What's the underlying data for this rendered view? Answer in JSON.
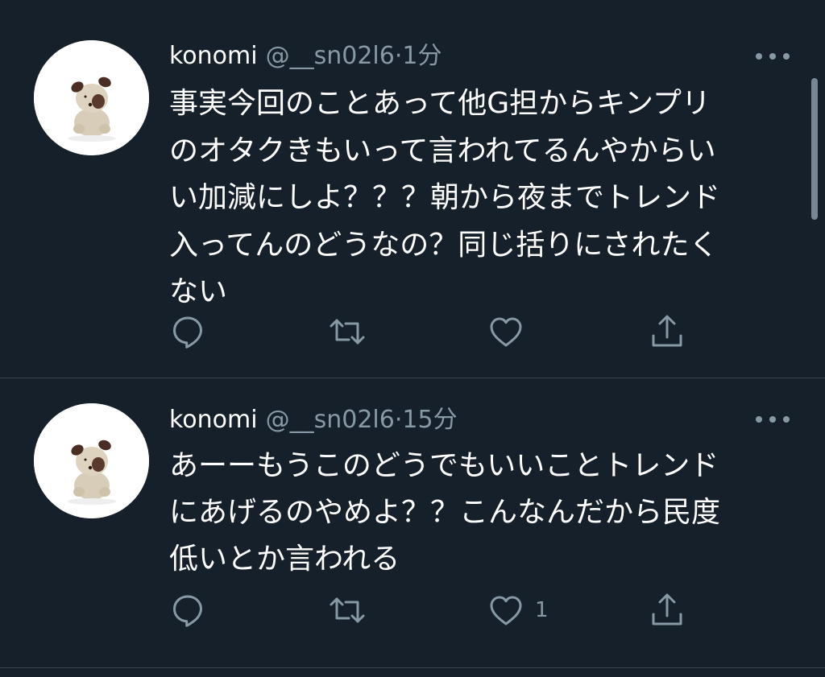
{
  "tweets": [
    {
      "name": "konomi",
      "handle": "@__sn02l6",
      "separator": "·",
      "time": "1分",
      "text": "事実今回のことあって他G担からキンプリ\nのオタクきもいって言われてるんやからい\nい加減にしよ？？？朝から夜までトレンド\n入ってんのどうなの？同じ括りにされたく\nない",
      "likes": ""
    },
    {
      "name": "konomi",
      "handle": "@__sn02l6",
      "separator": "·",
      "time": "15分",
      "text": "あーーもうこのどうでもいいことトレンド\nにあげるのやめよ？？こんなんだから民度\n低いとか言われる",
      "likes": "1"
    }
  ],
  "icons": {
    "more": "more-horizontal-icon",
    "reply": "reply-icon",
    "retweet": "retweet-icon",
    "like": "heart-icon",
    "share": "share-icon",
    "avatar": "stuffed-dog-avatar"
  },
  "colors": {
    "background": "#15202b",
    "secondary_text": "#8899a6",
    "divider": "#38444d",
    "primary_text": "#ffffff"
  }
}
